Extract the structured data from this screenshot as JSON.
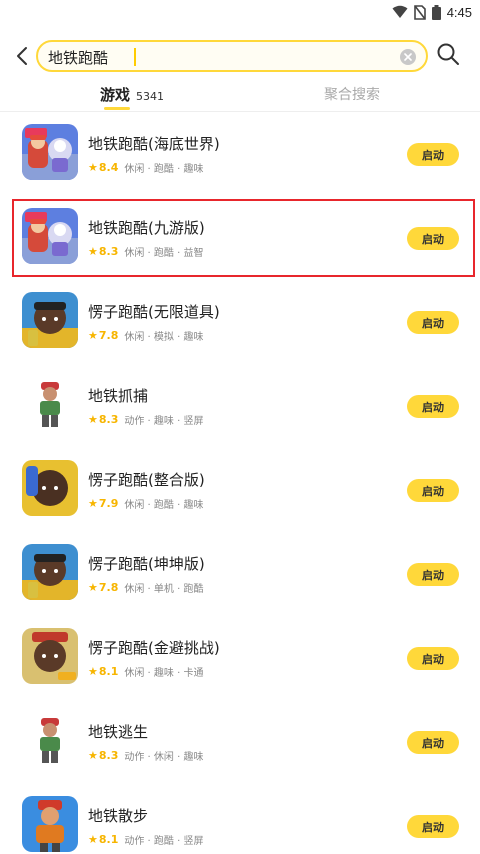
{
  "status_bar": {
    "time": "4:45"
  },
  "search": {
    "query": "地铁跑酷"
  },
  "tabs": [
    {
      "label": "游戏",
      "count": "5341",
      "active": true
    },
    {
      "label": "聚合搜索",
      "active": false
    }
  ],
  "colors": {
    "accent": "#ffd83a",
    "star": "#f7b500",
    "highlight": "#e8262c"
  },
  "games": [
    {
      "title": "地铁跑酷(海底世界)",
      "rating": "8.4",
      "tags": "休闲 · 跑酷 · 趣味",
      "button": "启动",
      "icon": "subway-surfers-icon"
    },
    {
      "title": "地铁跑酷(九游版)",
      "rating": "8.3",
      "tags": "休闲 · 跑酷 · 益智",
      "button": "启动",
      "icon": "subway-surfers-icon",
      "highlighted": true
    },
    {
      "title": "愣子跑酷(无限道具)",
      "rating": "7.8",
      "tags": "休闲 · 模拟 · 趣味",
      "button": "启动",
      "icon": "runner-face-icon"
    },
    {
      "title": "地铁抓捕",
      "rating": "8.3",
      "tags": "动作 · 趣味 · 竖屏",
      "button": "启动",
      "icon": "runner-character-icon"
    },
    {
      "title": "愣子跑酷(整合版)",
      "rating": "7.9",
      "tags": "休闲 · 跑酷 · 趣味",
      "button": "启动",
      "icon": "runner-face-icon"
    },
    {
      "title": "愣子跑酷(坤坤版)",
      "rating": "7.8",
      "tags": "休闲 · 单机 · 跑酷",
      "button": "启动",
      "icon": "runner-face-icon"
    },
    {
      "title": " 愣子跑酷(金避挑战)",
      "rating": "8.1",
      "tags": "休闲 · 趣味 · 卡通",
      "button": "启动",
      "icon": "runner-face-icon"
    },
    {
      "title": "地铁逃生",
      "rating": "8.3",
      "tags": "动作 · 休闲 · 趣味",
      "button": "启动",
      "icon": "runner-character-icon"
    },
    {
      "title": "地铁散步",
      "rating": "8.1",
      "tags": "动作 · 跑酷 · 竖屏",
      "button": "启动",
      "icon": "runner-character-icon"
    }
  ]
}
